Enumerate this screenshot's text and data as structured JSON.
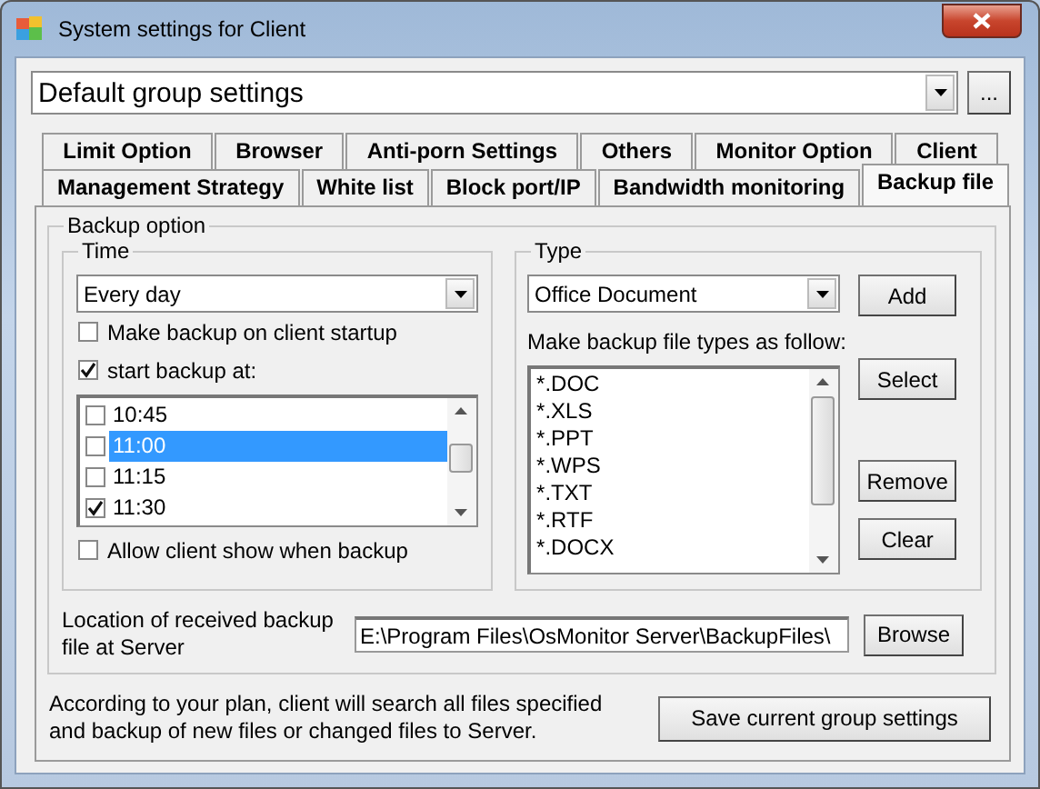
{
  "window": {
    "title": "System settings for Client"
  },
  "group_select": {
    "value": "Default group settings"
  },
  "more_button": "...",
  "tab_rows": [
    [
      {
        "label": "Limit Option",
        "selected": false
      },
      {
        "label": "Browser",
        "selected": false
      },
      {
        "label": "Anti-porn Settings",
        "selected": false
      },
      {
        "label": "Others",
        "selected": false
      },
      {
        "label": "Monitor Option",
        "selected": false
      },
      {
        "label": "Client",
        "selected": false
      }
    ],
    [
      {
        "label": "Management Strategy",
        "selected": false
      },
      {
        "label": "White list",
        "selected": false
      },
      {
        "label": "Block port/IP",
        "selected": false
      },
      {
        "label": "Bandwidth monitoring",
        "selected": false
      },
      {
        "label": "Backup file",
        "selected": true
      }
    ]
  ],
  "backup_option": {
    "title": "Backup option",
    "time": {
      "title": "Time",
      "frequency": "Every day",
      "options": [
        {
          "label": "Make backup on client startup",
          "checked": false
        },
        {
          "label": "start backup at:",
          "checked": true
        }
      ],
      "times": [
        {
          "label": "10:45",
          "checked": false,
          "selected": false
        },
        {
          "label": "11:00",
          "checked": false,
          "selected": true
        },
        {
          "label": "11:15",
          "checked": false,
          "selected": false
        },
        {
          "label": "11:30",
          "checked": true,
          "selected": false
        }
      ],
      "allow_show": {
        "label": "Allow client show when backup",
        "checked": false
      }
    },
    "type": {
      "title": "Type",
      "value": "Office Document",
      "add_button": "Add",
      "list_label": "Make backup file types as follow:",
      "file_types": [
        "*.DOC",
        "*.XLS",
        "*.PPT",
        "*.WPS",
        "*.TXT",
        "*.RTF",
        "*.DOCX"
      ],
      "buttons": [
        "Select",
        "Remove",
        "Clear"
      ]
    },
    "location": {
      "label": "Location of received backup file at Server",
      "value": "E:\\Program Files\\OsMonitor Server\\BackupFiles\\",
      "browse_button": "Browse"
    }
  },
  "note": "According to your plan, client will search all files specified and backup of new files or changed files to Server.",
  "save_button": "Save current group settings"
}
